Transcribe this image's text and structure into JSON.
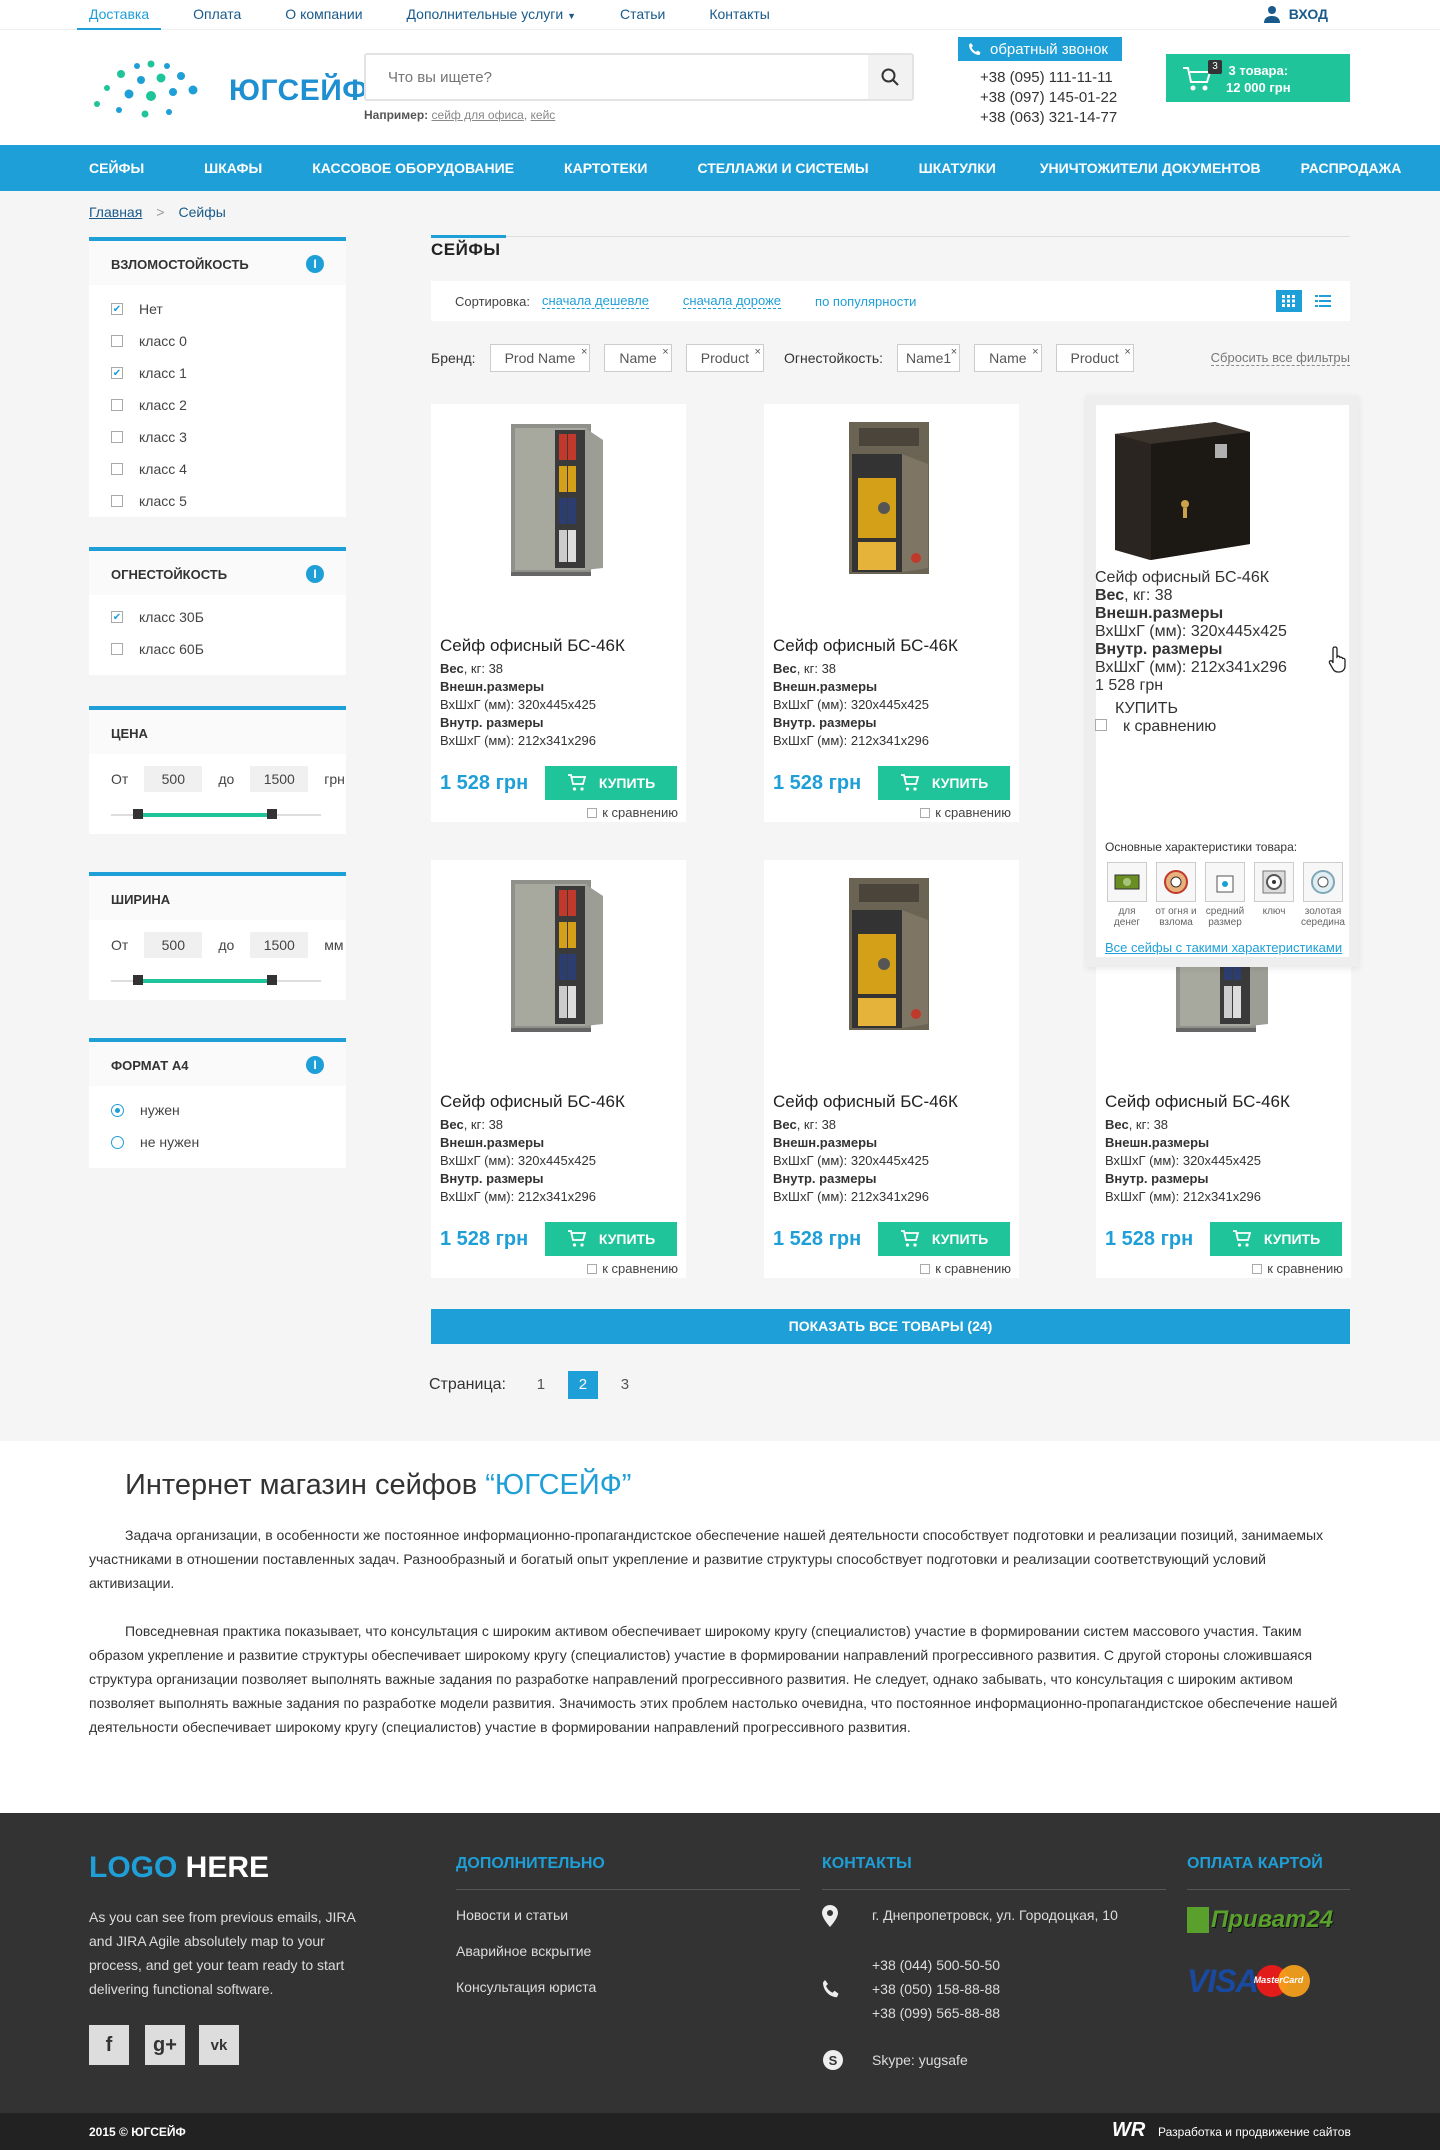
{
  "topbar": {
    "items": [
      "Доставка",
      "Оплата",
      "О компании",
      "Дополнительные услуги",
      "Статьи",
      "Контакты"
    ],
    "login": "ВХОД"
  },
  "header": {
    "logo_text": "ЮГСЕЙФ",
    "search_placeholder": "Что вы ищете?",
    "hint_prefix": "Например:",
    "hint_link1": "сейф для офиса",
    "hint_sep": ",",
    "hint_link2": "кейс",
    "callback": "обратный звонок",
    "phones": [
      "+38 (095) 111-11-11",
      "+38 (097) 145-01-22",
      "+38 (063) 321-14-77"
    ],
    "cart_count": "3",
    "cart_line1": "3 товара:",
    "cart_line2": "12 000 грн"
  },
  "mainnav": [
    "СЕЙФЫ",
    "ШКАФЫ",
    "КАССОВОЕ ОБОРУДОВАНИЕ",
    "КАРТОТЕКИ",
    "СТЕЛЛАЖИ И СИСТЕМЫ",
    "ШКАТУЛКИ",
    "УНИЧТОЖИТЕЛИ ДОКУМЕНТОВ",
    "РАСПРОДАЖА"
  ],
  "breadcrumb": {
    "home": "Главная",
    "sep": ">",
    "current": "Сейфы"
  },
  "filters": {
    "burglary": {
      "title": "ВЗЛОМОСТОЙКОСТЬ",
      "options": [
        "Нет",
        "класс 0",
        "класс 1",
        "класс 2",
        "класс 3",
        "класс 4",
        "класс 5"
      ],
      "checked": [
        true,
        false,
        true,
        false,
        false,
        false,
        false
      ]
    },
    "fire": {
      "title": "ОГНЕСТОЙКОСТЬ",
      "options": [
        "класс 30Б",
        "класс 60Б"
      ],
      "checked": [
        true,
        false
      ]
    },
    "price": {
      "title": "ЦЕНА",
      "from_label": "От",
      "from": "500",
      "to_label": "до",
      "to": "1500",
      "unit": "грн"
    },
    "width": {
      "title": "ШИРИНА",
      "from_label": "От",
      "from": "500",
      "to_label": "до",
      "to": "1500",
      "unit": "мм"
    },
    "a4": {
      "title": "ФОРМАТ А4",
      "options": [
        "нужен",
        "не нужен"
      ],
      "selected": 0
    },
    "info": "i"
  },
  "content": {
    "title": "СЕЙФЫ",
    "sort_label": "Сортировка:",
    "sort_options": [
      "сначала дешевле",
      "сначала дороже",
      "по популярности"
    ],
    "brand_label": "Бренд:",
    "brand_chips": [
      "Prod Name",
      "Name",
      "Product"
    ],
    "fire_label": "Огнестойкость:",
    "fire_chips": [
      "Name1",
      "Name",
      "Product"
    ],
    "chip_x": "×",
    "reset": "Сбросить все фильтры"
  },
  "product": {
    "title": "Сейф офисный БС-46К",
    "weight_label": "Вес",
    "weight_value": ", кг: 38",
    "outer_label": "Внешн.размеры",
    "outer_value": "ВхШхГ (мм): 320х445х425",
    "inner_label": "Внутр. размеры",
    "inner_value": "ВхШхГ (мм): 212х341х296",
    "price": "1 528 грн",
    "buy": "КУПИТЬ",
    "compare": "к сравнению"
  },
  "hover_features": {
    "title": "Основные характеристики товара:",
    "items": [
      "для денег",
      "от огня и взлома",
      "средний размер",
      "ключ",
      "золотая середина"
    ],
    "link": "Все сейфы с такими характеристиками"
  },
  "showall": "ПОКАЗАТЬ ВСЕ ТОВАРЫ (24)",
  "pager": {
    "label": "Страница:",
    "pages": [
      "1",
      "2",
      "3"
    ],
    "current": 1
  },
  "seo": {
    "title_prefix": "Интернет магазин сейфов ",
    "title_brand": "“ЮГСЕЙФ”",
    "p1": "Задача организации, в особенности же постоянное информационно-пропагандистское обеспечение нашей деятельности способствует подготовки и реализации позиций, занимаемых участниками в отношении поставленных задач. Разнообразный и богатый опыт укрепление и развитие структуры способствует подготовки и реализации соответствующий условий активизации.",
    "p2": "Повседневная практика показывает, что консультация с широким активом обеспечивает широкому кругу (специалистов) участие в формировании систем массового участия. Таким образом укрепление и развитие структуры обеспечивает широкому кругу (специалистов) участие в формировании направлений прогрессивного развития. С другой стороны сложившаяся структура организации позволяет выполнять важные задания по разработке направлений прогрессивного развития. Не следует, однако забывать, что консультация с широким активом позволяет выполнять важные задания по разработке модели развития. Значимость этих проблем настолько очевидна, что постоянное информационно-пропагандистское обеспечение нашей деятельности обеспечивает широкому кругу (специалистов) участие в формировании направлений прогрессивного развития."
  },
  "footer": {
    "logo_a": "LOGO",
    "logo_b": " HERE",
    "desc": "As you can see from previous emails, JIRA and JIRA Agile absolutely map to your process, and get your team ready to start delivering functional software.",
    "social": [
      "f",
      "g+",
      "vk"
    ],
    "extra_title": "ДОПОЛНИТЕЛЬНО",
    "extra_links": [
      "Новости и статьи",
      "Аварийное вскрытие",
      "Консультация юриста"
    ],
    "contacts_title": "КОНТАКТЫ",
    "address": "г. Днепропетровск, ул. Городоцкая, 10",
    "phones": [
      "+38 (044) 500-50-50",
      "+38 (050) 158-88-88",
      "+38 (099) 565-88-88"
    ],
    "skype": "Skype:  yugsafe",
    "pay_title": "ОПЛАТА КАРТОЙ",
    "privat": "Приват24",
    "visa": "VISA",
    "mastercard": "MasterCard"
  },
  "bottom": {
    "copyright": "2015 © ЮГСЕЙФ",
    "dev_logo": "WR",
    "dev": "Разработка и продвижение сайтов"
  },
  "colors": {
    "accent": "#1e9fd8",
    "green": "#20c49a",
    "footer": "#333333"
  }
}
